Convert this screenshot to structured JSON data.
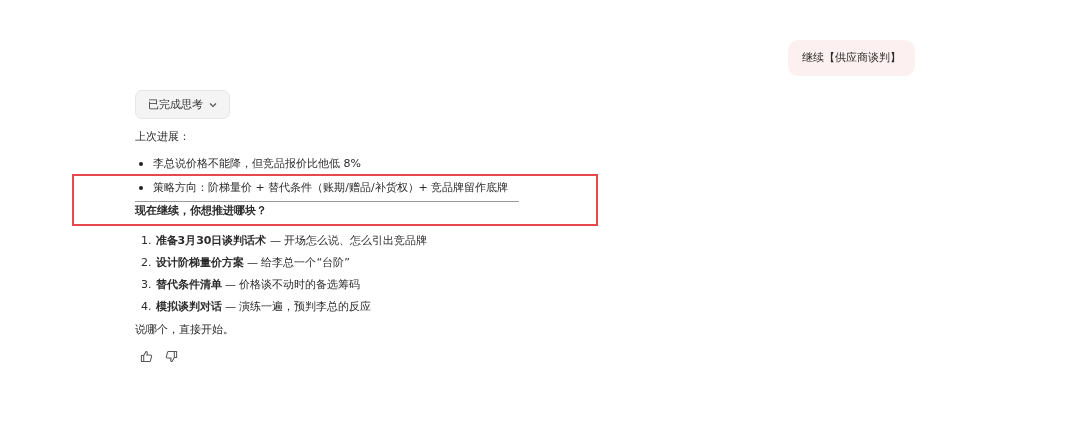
{
  "user_message": "继续【供应商谈判】",
  "thinking_button": {
    "label": "已完成思考",
    "expanded": false
  },
  "reply": {
    "intro": "上次进展：",
    "bullets": [
      "李总说价格不能降，但竞品报价比他低 8%",
      "策略方向：阶梯量价 + 替代条件（账期/赠品/补货权）+ 竞品牌留作底牌"
    ],
    "question": "现在继续，你想推进哪块？",
    "options": [
      {
        "number": "1.",
        "text": "**准备3月30日谈判话术** — 开场怎么说、怎么引出竞品牌"
      },
      {
        "number": "2.",
        "text": "**设计阶梯量价方案** — 给李总一个“台阶”"
      },
      {
        "number": "3.",
        "text": "**替代条件清单** — 价格谈不动时的备选筹码"
      },
      {
        "number": "4.",
        "text": "**模拟谈判对话** — 演练一遍，预判李总的反应"
      }
    ],
    "closing": "说哪个，直接开始。"
  },
  "highlight": {
    "color": "#e8474c"
  }
}
